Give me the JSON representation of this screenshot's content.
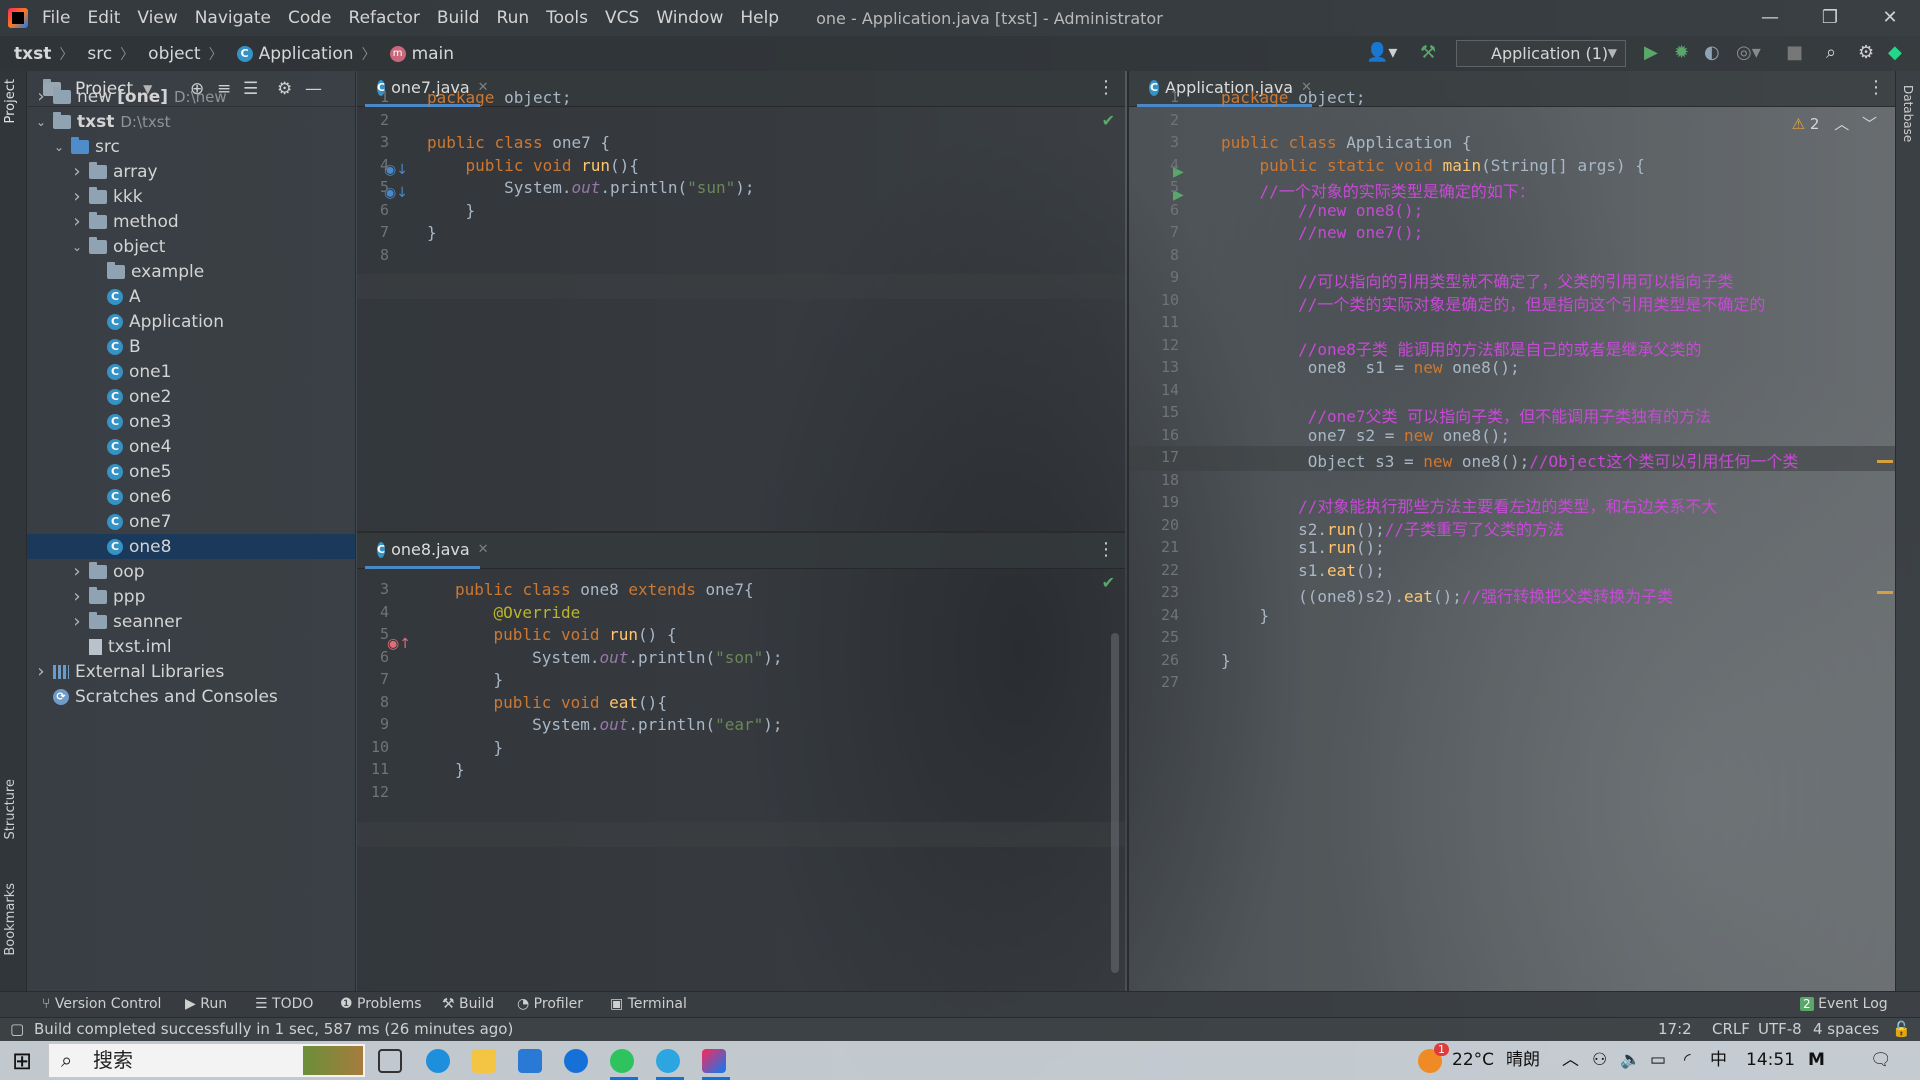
{
  "titlebar": {
    "menu": [
      "File",
      "Edit",
      "View",
      "Navigate",
      "Code",
      "Refactor",
      "Build",
      "Run",
      "Tools",
      "VCS",
      "Window",
      "Help"
    ],
    "window_title": "one - Application.java [txst] - Administrator",
    "controls": {
      "minimize": "—",
      "restore": "❐",
      "close": "✕"
    }
  },
  "navbar": {
    "breadcrumb": [
      "txst",
      "src",
      "object",
      "Application",
      "main"
    ],
    "run_config": "Application (1)"
  },
  "left_strip": {
    "project_tab": "Project",
    "structure_tab": "Structure",
    "bookmarks_tab": "Bookmarks"
  },
  "right_strip": {
    "database_tab": "Database"
  },
  "project_panel": {
    "title": "Project",
    "tree": [
      {
        "label": "new",
        "extra": "[one]",
        "hint": "D:\\new",
        "level": 0,
        "type": "module",
        "expanded": false
      },
      {
        "label": "txst",
        "extra": "",
        "hint": "D:\\txst",
        "level": 0,
        "type": "module",
        "expanded": true
      },
      {
        "label": "src",
        "extra": "",
        "hint": "",
        "level": 1,
        "type": "src",
        "expanded": true
      },
      {
        "label": "array",
        "extra": "",
        "hint": "",
        "level": 2,
        "type": "package",
        "expanded": false
      },
      {
        "label": "kkk",
        "extra": "",
        "hint": "",
        "level": 2,
        "type": "package",
        "expanded": false
      },
      {
        "label": "method",
        "extra": "",
        "hint": "",
        "level": 2,
        "type": "package",
        "expanded": false
      },
      {
        "label": "object",
        "extra": "",
        "hint": "",
        "level": 2,
        "type": "package",
        "expanded": true
      },
      {
        "label": "example",
        "extra": "",
        "hint": "",
        "level": 3,
        "type": "package-leaf",
        "expanded": null
      },
      {
        "label": "A",
        "extra": "",
        "hint": "",
        "level": 3,
        "type": "class",
        "expanded": null
      },
      {
        "label": "Application",
        "extra": "",
        "hint": "",
        "level": 3,
        "type": "class-main",
        "expanded": null
      },
      {
        "label": "B",
        "extra": "",
        "hint": "",
        "level": 3,
        "type": "class",
        "expanded": null
      },
      {
        "label": "one1",
        "extra": "",
        "hint": "",
        "level": 3,
        "type": "class",
        "expanded": null
      },
      {
        "label": "one2",
        "extra": "",
        "hint": "",
        "level": 3,
        "type": "class",
        "expanded": null
      },
      {
        "label": "one3",
        "extra": "",
        "hint": "",
        "level": 3,
        "type": "class",
        "expanded": null
      },
      {
        "label": "one4",
        "extra": "",
        "hint": "",
        "level": 3,
        "type": "class",
        "expanded": null
      },
      {
        "label": "one5",
        "extra": "",
        "hint": "",
        "level": 3,
        "type": "class",
        "expanded": null
      },
      {
        "label": "one6",
        "extra": "",
        "hint": "",
        "level": 3,
        "type": "class",
        "expanded": null
      },
      {
        "label": "one7",
        "extra": "",
        "hint": "",
        "level": 3,
        "type": "class",
        "expanded": null
      },
      {
        "label": "one8",
        "extra": "",
        "hint": "",
        "level": 3,
        "type": "class",
        "expanded": null,
        "selected": true
      },
      {
        "label": "oop",
        "extra": "",
        "hint": "",
        "level": 2,
        "type": "package",
        "expanded": false
      },
      {
        "label": "ppp",
        "extra": "",
        "hint": "",
        "level": 2,
        "type": "package",
        "expanded": false
      },
      {
        "label": "seanner",
        "extra": "",
        "hint": "",
        "level": 2,
        "type": "package",
        "expanded": false
      },
      {
        "label": "txst.iml",
        "extra": "",
        "hint": "",
        "level": 2,
        "type": "file",
        "expanded": null
      },
      {
        "label": "External Libraries",
        "extra": "",
        "hint": "",
        "level": 0,
        "type": "library",
        "expanded": false
      },
      {
        "label": "Scratches and Consoles",
        "extra": "",
        "hint": "",
        "level": 0,
        "type": "scratch",
        "expanded": null
      }
    ]
  },
  "editor_one7": {
    "tab": "one7.java",
    "lines": [
      {
        "n": "1",
        "code": "package object;"
      },
      {
        "n": "2",
        "code": ""
      },
      {
        "n": "3",
        "code": "public class one7 {"
      },
      {
        "n": "4",
        "code": "    public void run(){"
      },
      {
        "n": "5",
        "code": "        System.out.println(\"sun\");"
      },
      {
        "n": "6",
        "code": "    }"
      },
      {
        "n": "7",
        "code": "}"
      },
      {
        "n": "8",
        "code": ""
      }
    ]
  },
  "editor_one8": {
    "tab": "one8.java",
    "lines": [
      {
        "n": "3",
        "code": "public class one8 extends one7{"
      },
      {
        "n": "4",
        "code": "    @Override"
      },
      {
        "n": "5",
        "code": "    public void run() {"
      },
      {
        "n": "6",
        "code": "        System.out.println(\"son\");"
      },
      {
        "n": "7",
        "code": "    }"
      },
      {
        "n": "8",
        "code": "    public void eat(){"
      },
      {
        "n": "9",
        "code": "        System.out.println(\"ear\");"
      },
      {
        "n": "10",
        "code": "    }"
      },
      {
        "n": "11",
        "code": "}"
      },
      {
        "n": "12",
        "code": ""
      }
    ]
  },
  "editor_app": {
    "tab": "Application.java",
    "warnings": "2",
    "lines": [
      {
        "n": "1",
        "code": "package object;"
      },
      {
        "n": "2",
        "code": ""
      },
      {
        "n": "3",
        "code": "public class Application {"
      },
      {
        "n": "4",
        "code": "    public static void main(String[] args) {"
      },
      {
        "n": "5",
        "code": "    //一个对象的实际类型是确定的如下："
      },
      {
        "n": "6",
        "code": "        //new one8();"
      },
      {
        "n": "7",
        "code": "        //new one7();"
      },
      {
        "n": "8",
        "code": ""
      },
      {
        "n": "9",
        "code": "        //可以指向的引用类型就不确定了，父类的引用可以指向子类"
      },
      {
        "n": "10",
        "code": "        //一个类的实际对象是确定的，但是指向这个引用类型是不确定的"
      },
      {
        "n": "11",
        "code": ""
      },
      {
        "n": "12",
        "code": "        //one8子类 能调用的方法都是自己的或者是继承父类的"
      },
      {
        "n": "13",
        "code": "         one8  s1 = new one8();"
      },
      {
        "n": "14",
        "code": ""
      },
      {
        "n": "15",
        "code": "         //one7父类 可以指向子类，但不能调用子类独有的方法"
      },
      {
        "n": "16",
        "code": "         one7 s2 = new one8();"
      },
      {
        "n": "17",
        "code": "         Object s3 = new one8();//Object这个类可以引用任何一个类"
      },
      {
        "n": "18",
        "code": ""
      },
      {
        "n": "19",
        "code": "        //对象能执行那些方法主要看左边的类型，和右边关系不大"
      },
      {
        "n": "20",
        "code": "        s2.run();//子类重写了父类的方法"
      },
      {
        "n": "21",
        "code": "        s1.run();"
      },
      {
        "n": "22",
        "code": "        s1.eat();"
      },
      {
        "n": "23",
        "code": "        ((one8)s2).eat();//强行转换把父类转换为子类"
      },
      {
        "n": "24",
        "code": "    }"
      },
      {
        "n": "25",
        "code": ""
      },
      {
        "n": "26",
        "code": "}"
      },
      {
        "n": "27",
        "code": ""
      }
    ]
  },
  "bottom_tools": [
    "Version Control",
    "Run",
    "TODO",
    "Problems",
    "Build",
    "Profiler",
    "Terminal"
  ],
  "event_log": {
    "count": "2",
    "label": "Event Log"
  },
  "status": {
    "message": "Build completed successfully in 1 sec, 587 ms (26 minutes ago)",
    "position": "17:2",
    "line_sep": "CRLF",
    "encoding": "UTF-8",
    "indent": "4 spaces"
  },
  "taskbar": {
    "search_placeholder": "搜索",
    "weather_badge": "1",
    "temperature": "22°C",
    "weather": "晴朗",
    "ime": "中",
    "time": "14:51"
  },
  "colors": {
    "keyword": "#cc7832",
    "function": "#ffc66d",
    "string": "#6a8759",
    "comment": "#c74ad6",
    "accent": "#4a88c7"
  }
}
